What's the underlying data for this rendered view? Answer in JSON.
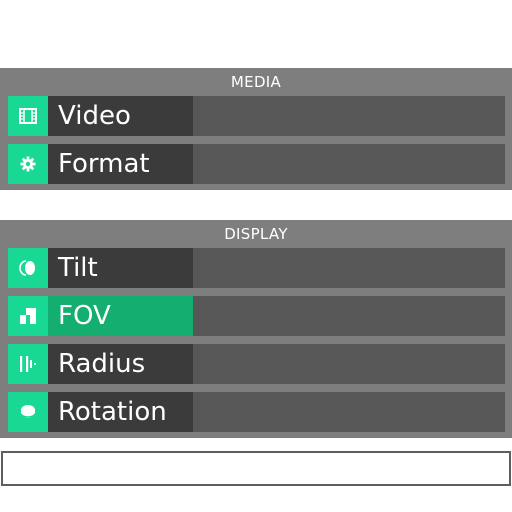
{
  "media": {
    "title": "MEDIA",
    "items": [
      {
        "label": "Video",
        "icon": "film-icon"
      },
      {
        "label": "Format",
        "icon": "gear-icon"
      }
    ]
  },
  "display": {
    "title": "DISPLAY",
    "items": [
      {
        "label": "Tilt",
        "icon": "tilt-icon"
      },
      {
        "label": "FOV",
        "icon": "fov-icon",
        "active": true
      },
      {
        "label": "Radius",
        "icon": "radius-icon"
      },
      {
        "label": "Rotation",
        "icon": "rotation-icon"
      }
    ]
  },
  "input": {
    "value": "",
    "placeholder": ""
  },
  "colors": {
    "accent": "#18d894",
    "active": "#14ae71",
    "panel": "#7e7e7e",
    "label_bg": "#3b3b3b",
    "value_bg": "#575757"
  }
}
